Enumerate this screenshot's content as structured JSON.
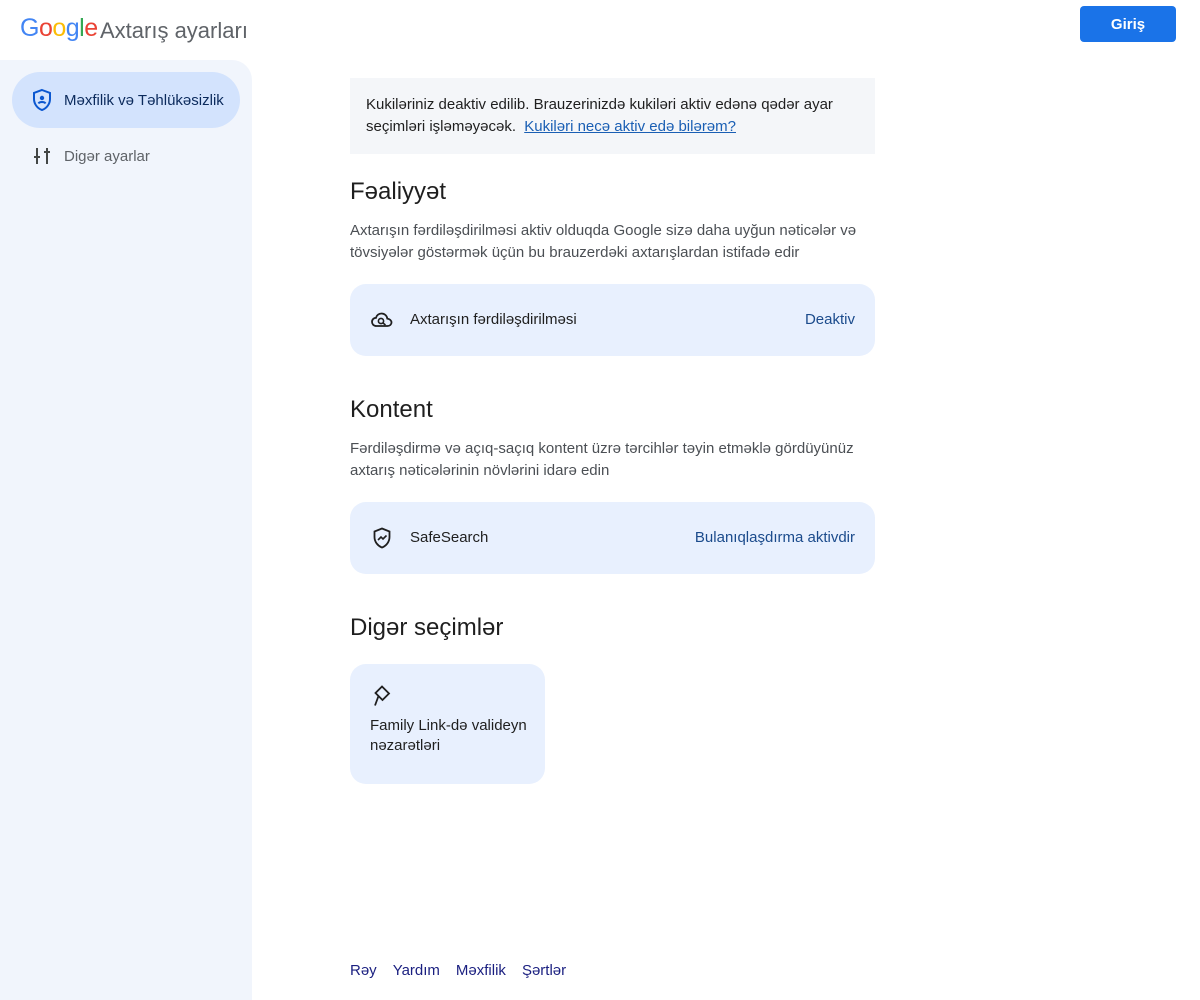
{
  "header": {
    "logo_letters": [
      {
        "ch": "G",
        "color": "#4285f4"
      },
      {
        "ch": "o",
        "color": "#ea4335"
      },
      {
        "ch": "o",
        "color": "#fbbc05"
      },
      {
        "ch": "g",
        "color": "#4285f4"
      },
      {
        "ch": "l",
        "color": "#34a853"
      },
      {
        "ch": "e",
        "color": "#ea4335"
      }
    ],
    "title": "Axtarış ayarları",
    "signin_label": "Giriş"
  },
  "sidebar": {
    "items": [
      {
        "label": "Məxfilik və Təhlükəsizlik",
        "icon": "shield-person-icon",
        "active": true
      },
      {
        "label": "Digər ayarlar",
        "icon": "sliders-icon",
        "active": false
      }
    ]
  },
  "notice": {
    "text": "Kukiləriniz deaktiv edilib. Brauzerinizdə kukiləri aktiv edənə qədər ayar seçimləri işləməyəcək.",
    "link": "Kukiləri necə aktiv edə bilərəm?"
  },
  "activity": {
    "title": "Fəaliyyət",
    "description": "Axtarışın fərdiləşdirilməsi aktiv olduqda Google sizə daha uyğun nəticələr və tövsiyələr göstərmək üçün bu brauzerdəki axtarışlardan istifadə edir",
    "card": {
      "label": "Axtarışın fərdiləşdirilməsi",
      "value": "Deaktiv",
      "icon": "cloud-search-icon"
    }
  },
  "content": {
    "title": "Kontent",
    "description": "Fərdiləşdirmə və açıq-saçıq kontent üzrə tərcihlər təyin etməklə gördüyünüz axtarış nəticələrinin növlərini idarə edin",
    "card": {
      "label": "SafeSearch",
      "value": "Bulanıqlaşdırma aktivdir",
      "icon": "shield-check-icon"
    }
  },
  "other": {
    "title": "Digər seçimlər",
    "tile": {
      "label": "Family Link-də valideyn nəzarətləri",
      "icon": "family-link-icon"
    }
  },
  "footer": {
    "links": [
      "Rəy",
      "Yardım",
      "Məxfilik",
      "Şərtlər"
    ]
  },
  "colors": {
    "accent": "#1a73e8",
    "sidebar_bg": "#f1f5fc",
    "active_item": "#d3e3fd",
    "card_bg": "#e8f0fe"
  }
}
